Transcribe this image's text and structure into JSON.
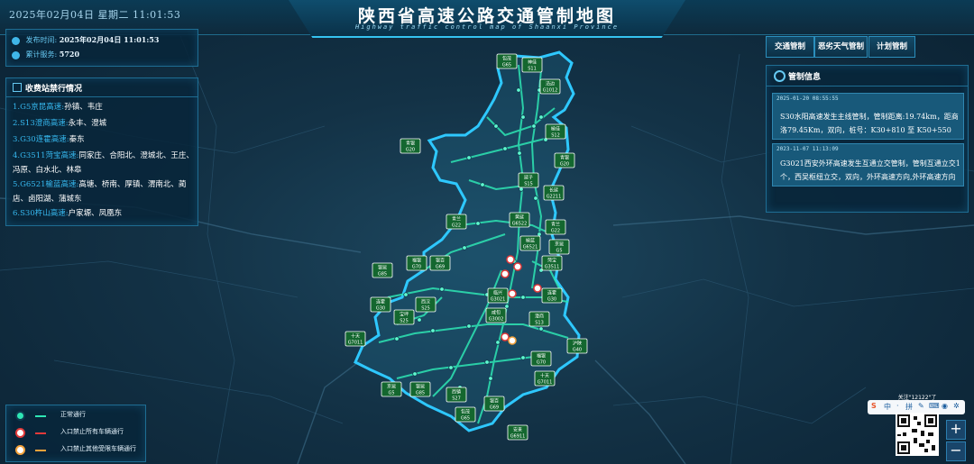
{
  "header": {
    "datetime": "2025年02月04日 星期二  11:01:53",
    "title": "陕西省高速公路交通管制地图",
    "subtitle": "Highway traffic control map of Shaanxi Province"
  },
  "info": {
    "publish_label": "发布时间:",
    "publish_value": "2025年02月04日  11:01:53",
    "service_label": "累计服务:",
    "service_value": "5720"
  },
  "toll_panel": {
    "title": "收费站禁行情况",
    "items": [
      {
        "road": "1.G5京昆高速:",
        "stations": "孙镇、韦庄"
      },
      {
        "road": "2.S13澄商高速:",
        "stations": "永丰、澄城"
      },
      {
        "road": "3.G30连霍高速:",
        "stations": "秦东"
      },
      {
        "road": "4.G3511菏宝高速:",
        "stations": "同家庄、合阳北、澄城北、王庄、冯原、白水北、林皋"
      },
      {
        "road": "5.G6521榆蓝高速:",
        "stations": "高塘、桥南、厚镇、渭南北、蔺店、卤阳湖、蒲城东"
      },
      {
        "road": "6.S30杵山高速:",
        "stations": "户家塬、凤凰东"
      }
    ]
  },
  "right_buttons": [
    "交通管制",
    "恶劣天气管制",
    "计划管制"
  ],
  "control_panel": {
    "title": "管制信息",
    "notices": [
      {
        "time": "2025-01-20 08:55:55",
        "text": "S30水阳高速发生主线管制，管制距离:19.74km，距商洛79.45Km，双向，桩号：K30+810 至 K50+550"
      },
      {
        "time": "2023-11-07 11:13:09",
        "text": "G3021西安外环高速发生互通立交管制，管制互通立交1个，西吴枢纽立交，双向，外环高速方向,外环高速方向"
      }
    ]
  },
  "legend": [
    {
      "label": "正常通行",
      "color": "#2ee6b4",
      "symbol": "dot-icon"
    },
    {
      "label": "入口禁止所有车辆通行",
      "color": "#e23a3a",
      "symbol": "no-entry-icon"
    },
    {
      "label": "入口禁止其他受限车辆通行",
      "color": "#f2a23a",
      "symbol": "no-entry-icon"
    }
  ],
  "qr": {
    "caption": "关注\"12122\"了"
  },
  "zoom": {
    "in": "+",
    "out": "−"
  },
  "ime": {
    "items": [
      "S",
      "中",
      "·",
      "拼",
      "✎",
      "⌨",
      "◉",
      "✲"
    ]
  },
  "route_signs": [
    {
      "name": "包茂",
      "code": "G65"
    },
    {
      "name": "神佳",
      "code": "S11"
    },
    {
      "name": "沿边",
      "code": "G1012"
    },
    {
      "name": "榆佳",
      "code": "S12"
    },
    {
      "name": "青银",
      "code": "G20"
    },
    {
      "name": "青银",
      "code": "G20"
    },
    {
      "name": "延子",
      "code": "S15"
    },
    {
      "name": "长延",
      "code": "G2211"
    },
    {
      "name": "青兰",
      "code": "G22"
    },
    {
      "name": "黄延",
      "code": "G6522"
    },
    {
      "name": "青兰",
      "code": "G22"
    },
    {
      "name": "榆蓝",
      "code": "G6521"
    },
    {
      "name": "京昆",
      "code": "G5"
    },
    {
      "name": "菏宝",
      "code": "G3511"
    },
    {
      "name": "银百",
      "code": "G69"
    },
    {
      "name": "银昆",
      "code": "G85"
    },
    {
      "name": "福银",
      "code": "G70"
    },
    {
      "name": "临兴",
      "code": "G3021"
    },
    {
      "name": "连霍",
      "code": "G30"
    },
    {
      "name": "连霍",
      "code": "G30"
    },
    {
      "name": "西汉",
      "code": "S25"
    },
    {
      "name": "宝坪",
      "code": "S25"
    },
    {
      "name": "咸旬",
      "code": "G3002"
    },
    {
      "name": "澄商",
      "code": "S13"
    },
    {
      "name": "十天",
      "code": "G7011"
    },
    {
      "name": "沪陕",
      "code": "G40"
    },
    {
      "name": "福银",
      "code": "G70"
    },
    {
      "name": "十天",
      "code": "G7011"
    },
    {
      "name": "京昆",
      "code": "G5"
    },
    {
      "name": "银昆",
      "code": "G85"
    },
    {
      "name": "西镇",
      "code": "S27"
    },
    {
      "name": "包茂",
      "code": "G65"
    },
    {
      "name": "银百",
      "code": "G69"
    },
    {
      "name": "安来",
      "code": "G6911"
    }
  ]
}
